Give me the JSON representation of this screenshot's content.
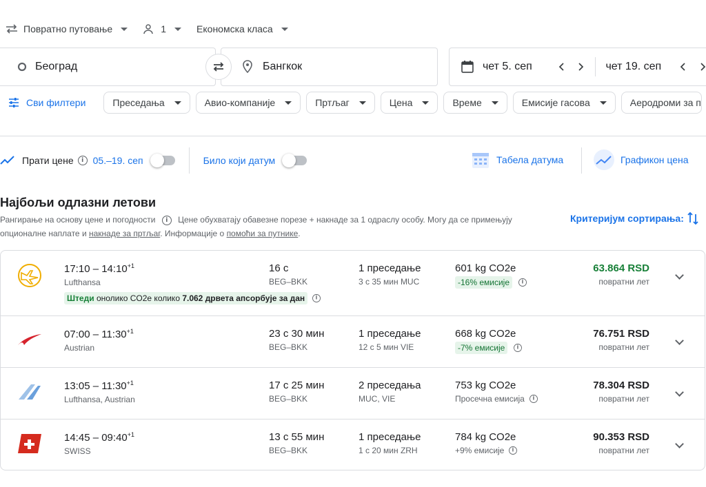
{
  "trip": {
    "type": "Повратно путовање",
    "passengers": "1",
    "cabin": "Економска класа"
  },
  "search": {
    "from": "Београд",
    "to": "Бангкок",
    "depart": "чет 5. сеп",
    "return": "чет 19. сеп"
  },
  "filters": {
    "all": "Сви филтери",
    "chips": [
      "Преседања",
      "Авио-компаније",
      "Пртљаг",
      "Цена",
      "Време",
      "Емисије гасова",
      "Аеродроми за п"
    ]
  },
  "tracking": {
    "track_label": "Прати цене",
    "range": "05.–19. сеп",
    "any_date": "Било који датум",
    "date_grid": "Табела датума",
    "price_graph": "Графикон цена"
  },
  "results": {
    "title": "Најбољи одлазни летови",
    "desc1": "Рангирање на основу цене и погодности",
    "desc2": "Цене обухватају обавезне порезе + накнаде за 1 одраслу особу. Могу да се примењују",
    "desc3a": "опционалне наплате и ",
    "desc3b": "накнаде за пртљаг",
    "desc3c": ". Информације о ",
    "desc3d": "помоћи за путнике",
    "desc3e": ".",
    "sort": "Критеријум сортирања:"
  },
  "flights": [
    {
      "times": "17:10 – 14:10",
      "plus": "+1",
      "airline": "Lufthansa",
      "duration": "16 с",
      "route": "BEG–BKK",
      "stops": "1 преседање",
      "stop_detail": "3 с 35 мин MUC",
      "co2": "601 kg CO2e",
      "emission": "-16% емисије",
      "emission_badge": true,
      "price": "63.864 RSD",
      "price_note": "повратни лет",
      "price_green": true,
      "eco_a": "Штеди ",
      "eco_b": "онолико CO2e колико ",
      "eco_c": "7.062 дрвета апсорбује за дан",
      "logo": "lufthansa-logo"
    },
    {
      "times": "07:00 – 11:30",
      "plus": "+1",
      "airline": "Austrian",
      "duration": "23 с 30 мин",
      "route": "BEG–BKK",
      "stops": "1 преседање",
      "stop_detail": "12 с 5 мин VIE",
      "co2": "668 kg CO2e",
      "emission": "-7% емисије",
      "emission_badge": true,
      "price": "76.751 RSD",
      "price_note": "повратни лет",
      "price_green": false,
      "logo": "austrian-logo"
    },
    {
      "times": "13:05 – 11:30",
      "plus": "+1",
      "airline": "Lufthansa, Austrian",
      "duration": "17 с 25 мин",
      "route": "BEG–BKK",
      "stops": "2 преседања",
      "stop_detail": "MUC, VIE",
      "co2": "753 kg CO2e",
      "emission": "Просечна емисија",
      "emission_badge": false,
      "price": "78.304 RSD",
      "price_note": "повратни лет",
      "price_green": false,
      "logo": "multi-airline-logo"
    },
    {
      "times": "14:45 – 09:40",
      "plus": "+1",
      "airline": "SWISS",
      "duration": "13 с 55 мин",
      "route": "BEG–BKK",
      "stops": "1 преседање",
      "stop_detail": "1 с 20 мин ZRH",
      "co2": "784 kg CO2e",
      "emission": "+9% емисије",
      "emission_badge": false,
      "price": "90.353 RSD",
      "price_note": "повратни лет",
      "price_green": false,
      "logo": "swiss-logo"
    }
  ]
}
